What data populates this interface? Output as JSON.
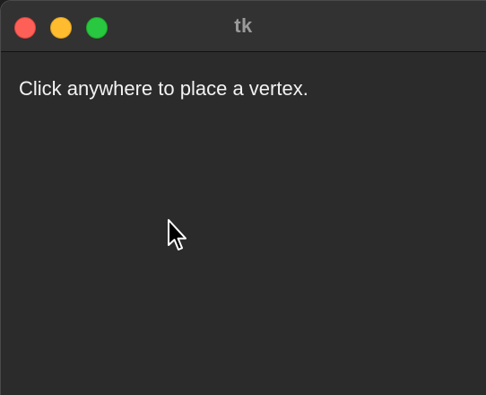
{
  "window": {
    "title": "tk",
    "traffic_lights": {
      "close_color": "#fe5f57",
      "minimize_color": "#febc2e",
      "zoom_color": "#28c840"
    },
    "background_color": "#2b2b2b"
  },
  "canvas": {
    "instruction": "Click anywhere to place a vertex."
  },
  "cursor": {
    "icon": "arrow-pointer-icon"
  }
}
